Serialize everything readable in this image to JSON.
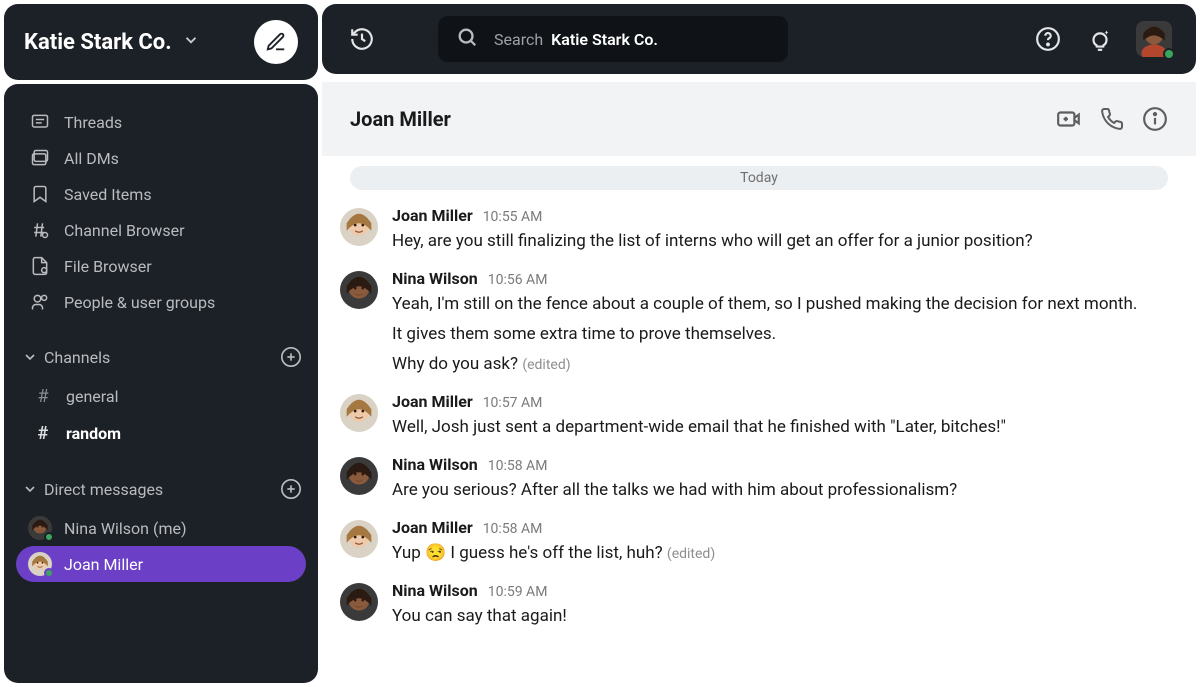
{
  "workspace": {
    "name": "Katie Stark Co."
  },
  "search": {
    "prefix": "Search",
    "scope": "Katie Stark Co."
  },
  "sidebar": {
    "nav": {
      "threads": "Threads",
      "all_dms": "All DMs",
      "saved": "Saved Items",
      "channel_browser": "Channel Browser",
      "file_browser": "File Browser",
      "people": "People & user groups"
    },
    "channels_label": "Channels",
    "channels": [
      {
        "name": "general",
        "bold": false
      },
      {
        "name": "random",
        "bold": true
      }
    ],
    "dms_label": "Direct messages",
    "dms": [
      {
        "name": "Nina Wilson (me)",
        "active": false,
        "avatar": "nina"
      },
      {
        "name": "Joan Miller",
        "active": true,
        "avatar": "joan"
      }
    ]
  },
  "conversation": {
    "title": "Joan Miller",
    "date_label": "Today",
    "messages": [
      {
        "author": "Joan Miller",
        "avatar": "joan",
        "time": "10:55 AM",
        "lines": [
          "Hey, are you still finalizing the list of interns who will get an offer for a junior position?"
        ],
        "edited": false,
        "emoji": null
      },
      {
        "author": "Nina Wilson",
        "avatar": "nina",
        "time": "10:56 AM",
        "lines": [
          "Yeah, I'm still on the fence about a couple of them, so I pushed making the decision for next month.",
          "It gives them some extra time to prove themselves.",
          "Why do you ask?"
        ],
        "edited": true,
        "emoji": null
      },
      {
        "author": "Joan Miller",
        "avatar": "joan",
        "time": "10:57 AM",
        "lines": [
          "Well, Josh just sent a department-wide email that he finished with \"Later, bitches!\""
        ],
        "edited": false,
        "emoji": null
      },
      {
        "author": "Nina Wilson",
        "avatar": "nina",
        "time": "10:58 AM",
        "lines": [
          "Are you serious? After all the talks we had with him about professionalism?"
        ],
        "edited": false,
        "emoji": null
      },
      {
        "author": "Joan Miller",
        "avatar": "joan",
        "time": "10:58 AM",
        "lines": [
          "Yup 😒 I guess he's off the list, huh?"
        ],
        "edited": true,
        "emoji": null
      },
      {
        "author": "Nina Wilson",
        "avatar": "nina",
        "time": "10:59 AM",
        "lines": [
          "You can say that again!"
        ],
        "edited": false,
        "emoji": null
      }
    ]
  },
  "labels": {
    "edited": "(edited)"
  },
  "avatars": {
    "joan": {
      "skin": "#f0c9a8",
      "hair": "#a67841",
      "bg": "#d9d2c5"
    },
    "nina": {
      "skin": "#8a5a3c",
      "hair": "#2b1a12",
      "bg": "#3a3a3a"
    }
  }
}
